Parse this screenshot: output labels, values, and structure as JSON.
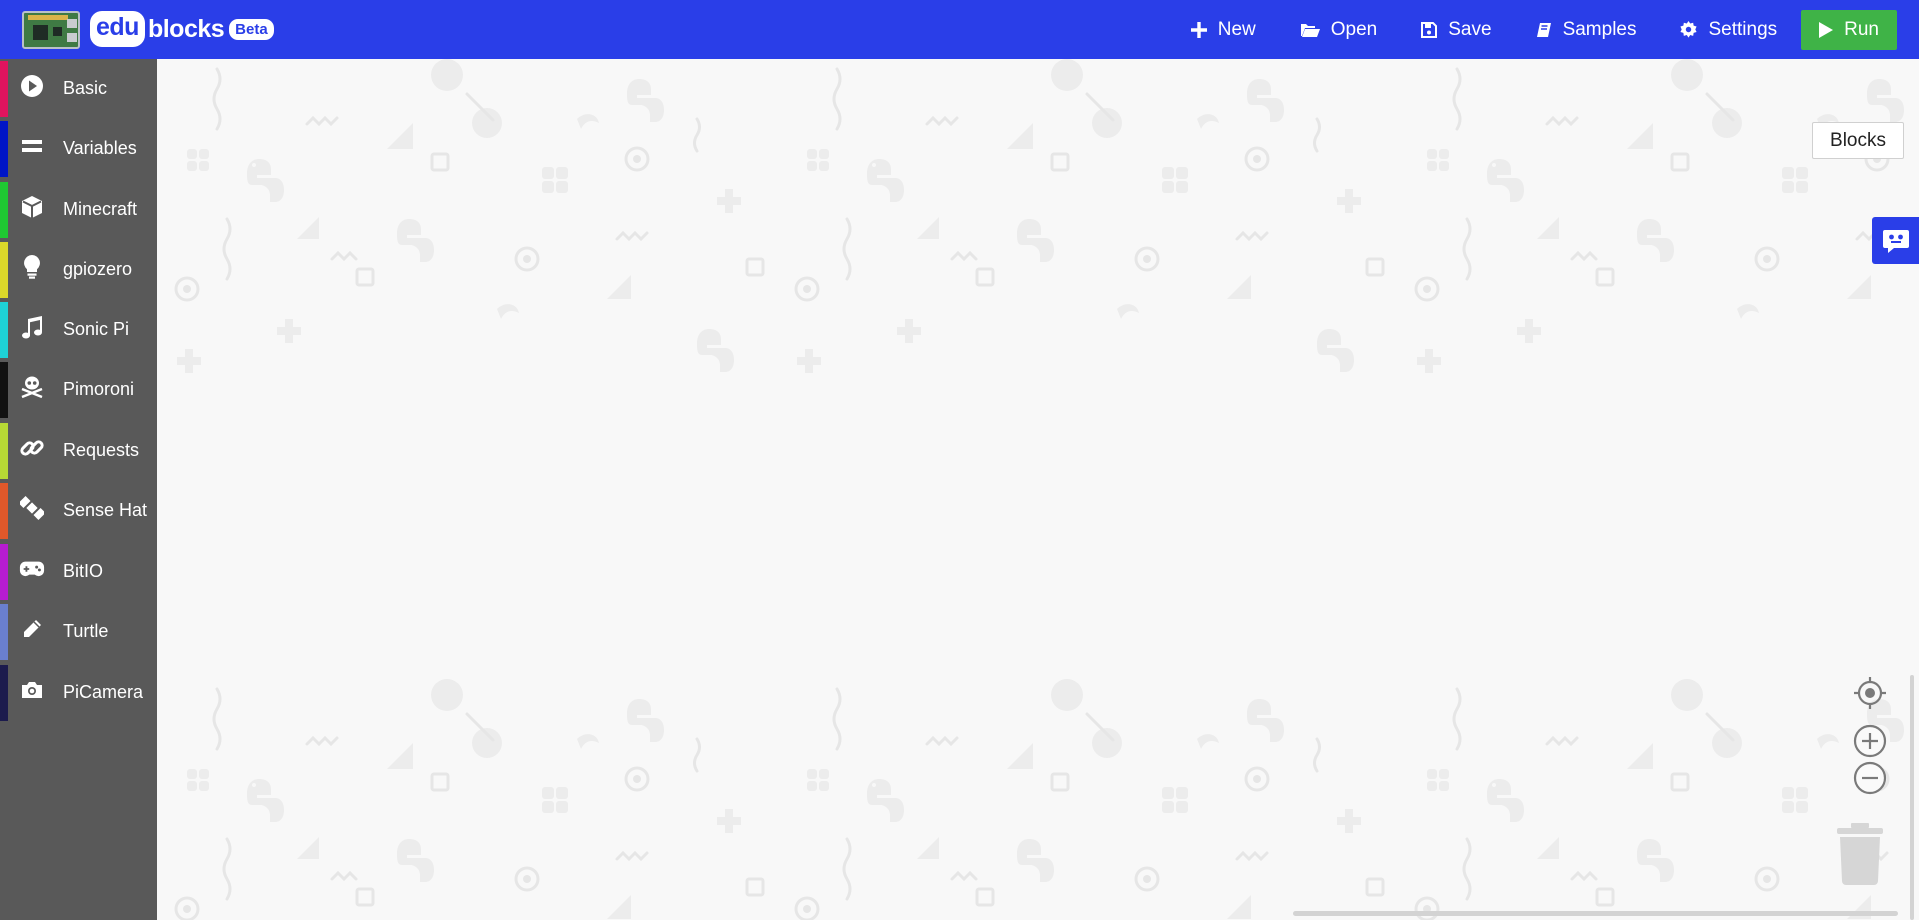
{
  "header": {
    "brand_edu": "edu",
    "brand_blocks": "blocks",
    "brand_beta": "Beta",
    "bg_color": "#2a3ee8",
    "nav": [
      {
        "label": "New",
        "icon": "plus-icon"
      },
      {
        "label": "Open",
        "icon": "folder-open-icon"
      },
      {
        "label": "Save",
        "icon": "floppy-disk-icon"
      },
      {
        "label": "Samples",
        "icon": "book-icon"
      },
      {
        "label": "Settings",
        "icon": "gear-icon"
      }
    ],
    "run": {
      "label": "Run",
      "icon": "play-icon",
      "color": "#3fb347"
    }
  },
  "sidebar": {
    "bg_color": "#595959",
    "categories": [
      {
        "label": "Basic",
        "icon": "play-circle-icon",
        "color": "#e0145e"
      },
      {
        "label": "Variables",
        "icon": "equals-icon",
        "color": "#0015c7"
      },
      {
        "label": "Minecraft",
        "icon": "cube-icon",
        "color": "#1fc832"
      },
      {
        "label": "gpiozero",
        "icon": "lightbulb-icon",
        "color": "#dcd82a"
      },
      {
        "label": "Sonic Pi",
        "icon": "music-note-icon",
        "color": "#1ed2d6"
      },
      {
        "label": "Pimoroni",
        "icon": "skull-crossbones-icon",
        "color": "#111111"
      },
      {
        "label": "Requests",
        "icon": "link-icon",
        "color": "#b7d935"
      },
      {
        "label": "Sense Hat",
        "icon": "satellite-icon",
        "color": "#e0582a"
      },
      {
        "label": "BitIO",
        "icon": "gamepad-icon",
        "color": "#b61cd1"
      },
      {
        "label": "Turtle",
        "icon": "pencil-icon",
        "color": "#6a7fce"
      },
      {
        "label": "PiCamera",
        "icon": "camera-icon",
        "color": "#1c1b4d"
      }
    ]
  },
  "workspace": {
    "view_tab": "Blocks",
    "feedback_icon": "chat-robot-icon",
    "controls": [
      "recenter-icon",
      "zoom-in-icon",
      "zoom-out-icon",
      "trash-can-icon"
    ]
  }
}
